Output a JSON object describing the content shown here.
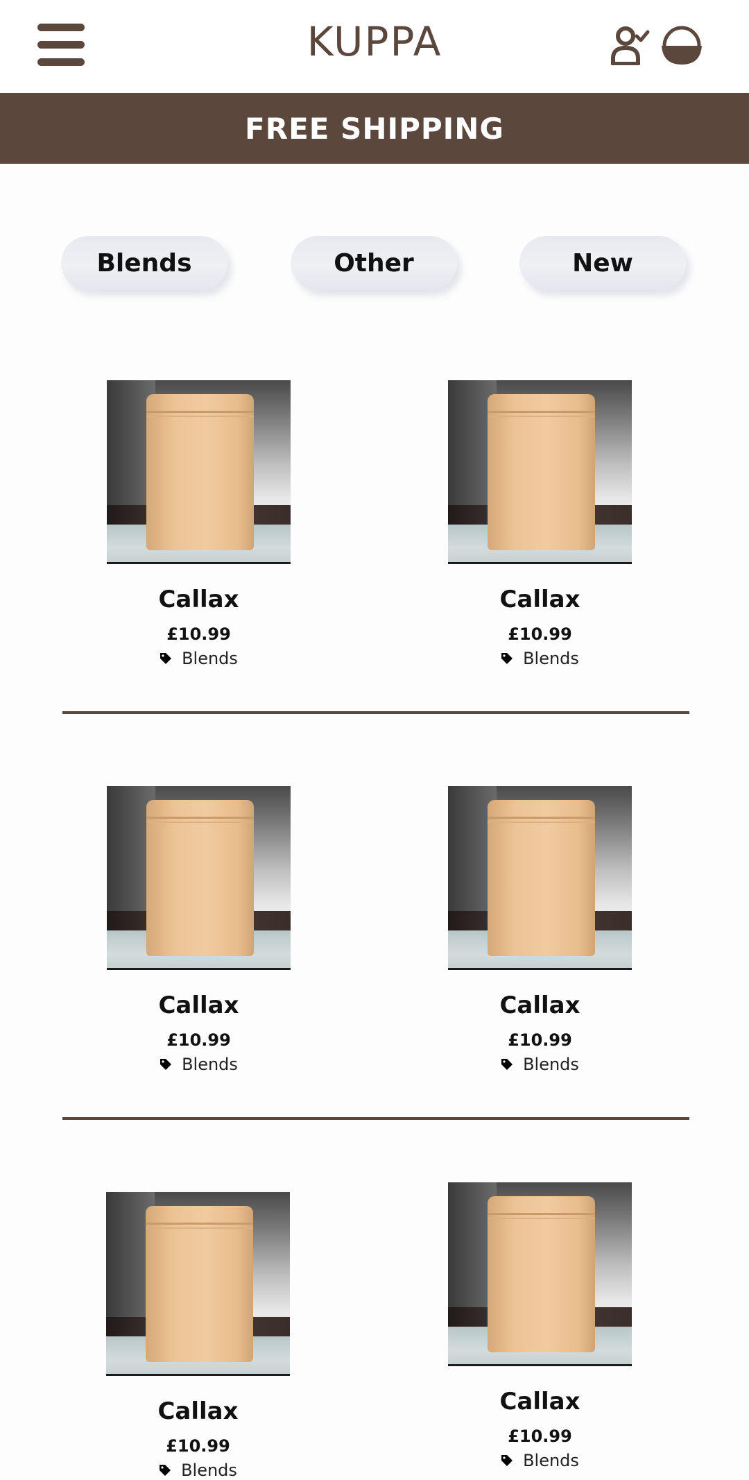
{
  "header": {
    "logo": "KUPPA",
    "menu_icon": "hamburger-menu-icon",
    "account_icon": "user-check-icon",
    "basket_icon": "basket-icon"
  },
  "banner": {
    "text": "FREE SHIPPING"
  },
  "filters": [
    {
      "label": "Blends"
    },
    {
      "label": "Other"
    },
    {
      "label": "New"
    }
  ],
  "products": [
    {
      "name": "Callax",
      "price": "£10.99",
      "category": "Blends"
    },
    {
      "name": "Callax",
      "price": "£10.99",
      "category": "Blends"
    },
    {
      "name": "Callax",
      "price": "£10.99",
      "category": "Blends"
    },
    {
      "name": "Callax",
      "price": "£10.99",
      "category": "Blends"
    },
    {
      "name": "Callax",
      "price": "£10.99",
      "category": "Blends"
    },
    {
      "name": "Callax",
      "price": "£10.99",
      "category": "Blends"
    }
  ],
  "colors": {
    "brand": "#5c473d",
    "pill_background": "#e9ecf1",
    "page_background": "#fdfdfd"
  }
}
